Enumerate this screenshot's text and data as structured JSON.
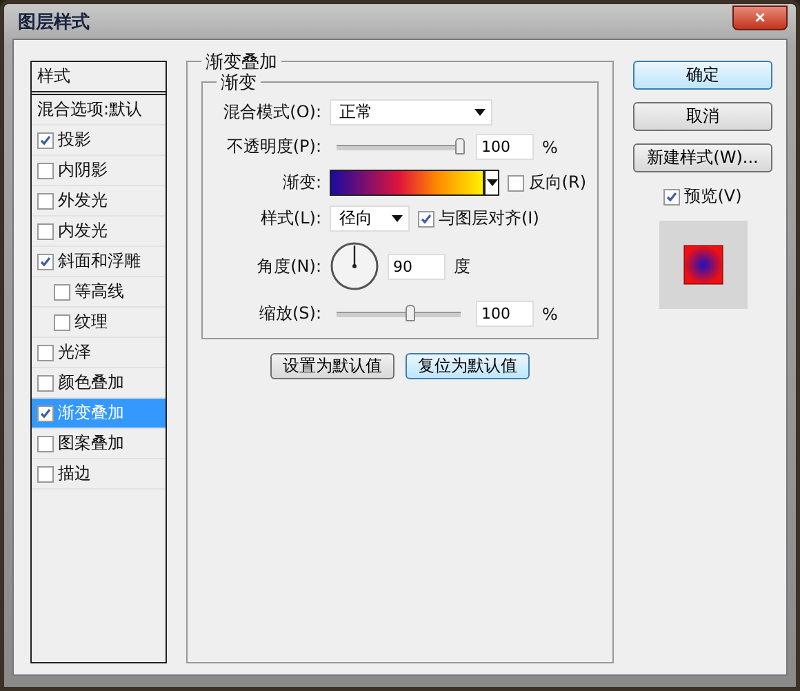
{
  "window": {
    "title": "图层样式",
    "close": "×"
  },
  "styles": [
    {
      "kind": "header",
      "label": "样式",
      "selected": false
    },
    {
      "kind": "option",
      "label": "混合选项:默认",
      "selected": false
    },
    {
      "kind": "effect",
      "label": "投影",
      "checked": true,
      "selected": false
    },
    {
      "kind": "effect",
      "label": "内阴影",
      "checked": false,
      "selected": false
    },
    {
      "kind": "effect",
      "label": "外发光",
      "checked": false,
      "selected": false
    },
    {
      "kind": "effect",
      "label": "内发光",
      "checked": false,
      "selected": false
    },
    {
      "kind": "effect",
      "label": "斜面和浮雕",
      "checked": true,
      "selected": false,
      "children": [
        {
          "kind": "effect",
          "label": "等高线",
          "checked": false,
          "selected": false
        },
        {
          "kind": "effect",
          "label": "纹理",
          "checked": false,
          "selected": false
        }
      ]
    },
    {
      "kind": "effect",
      "label": "光泽",
      "checked": false,
      "selected": false
    },
    {
      "kind": "effect",
      "label": "颜色叠加",
      "checked": false,
      "selected": false
    },
    {
      "kind": "effect",
      "label": "渐变叠加",
      "checked": true,
      "selected": true
    },
    {
      "kind": "effect",
      "label": "图案叠加",
      "checked": false,
      "selected": false
    },
    {
      "kind": "effect",
      "label": "描边",
      "checked": false,
      "selected": false
    }
  ],
  "panel": {
    "title": "渐变叠加",
    "group": "渐变",
    "blend_mode": {
      "label": "混合模式(O):",
      "value": "正常"
    },
    "opacity": {
      "label": "不透明度(P):",
      "level": 1,
      "value": "100",
      "unit": "%"
    },
    "gradient": {
      "label": "渐变:"
    },
    "reverse": {
      "label": "反向(R)",
      "checked": false
    },
    "style": {
      "label": "样式(L):",
      "value": "径向"
    },
    "align": {
      "label": "与图层对齐(I)",
      "checked": true
    },
    "angle": {
      "label": "角度(N):",
      "value": "90",
      "unit": "度"
    },
    "scale": {
      "label": "缩放(S):",
      "level": 0.6,
      "value": "100",
      "unit": "%"
    },
    "buttons": [
      {
        "label": "设置为默认值",
        "selected": false
      },
      {
        "label": "复位为默认值",
        "selected": true
      }
    ]
  },
  "actions": [
    {
      "label": "确定",
      "selected": true
    },
    {
      "label": "取消",
      "selected": false
    },
    {
      "label": "新建样式(W)...",
      "selected": false
    }
  ],
  "preview": {
    "label": "预览(V)",
    "checked": true
  }
}
